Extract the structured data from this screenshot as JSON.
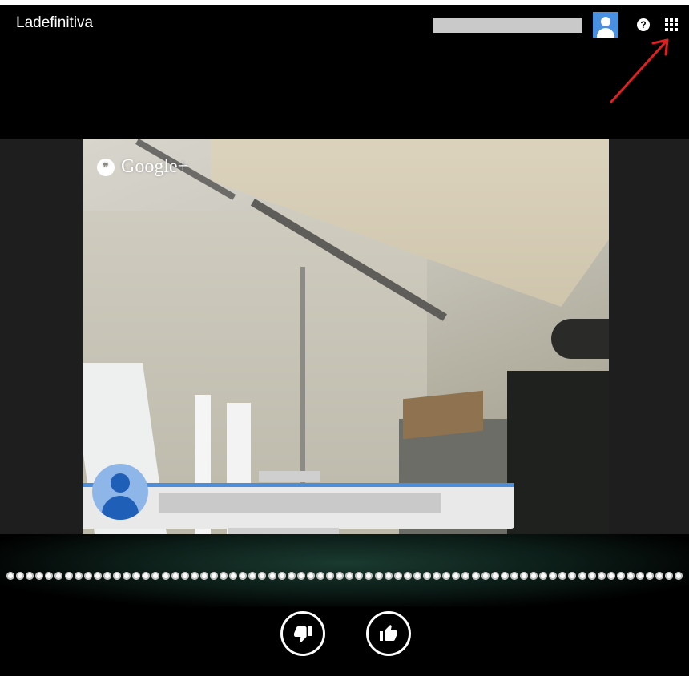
{
  "header": {
    "app_title": "Ladefinitiva"
  },
  "icons": {
    "help": "question-icon",
    "apps": "apps-grid-icon",
    "annotation": "red-arrow"
  },
  "video": {
    "watermark": "Google+"
  },
  "controls": {
    "thumbs_down_icon": "thumbs-down-icon",
    "thumbs_up_icon": "thumbs-up-icon"
  },
  "colors": {
    "accent_blue": "#4a8ee0",
    "arrow_red": "#e02020"
  }
}
